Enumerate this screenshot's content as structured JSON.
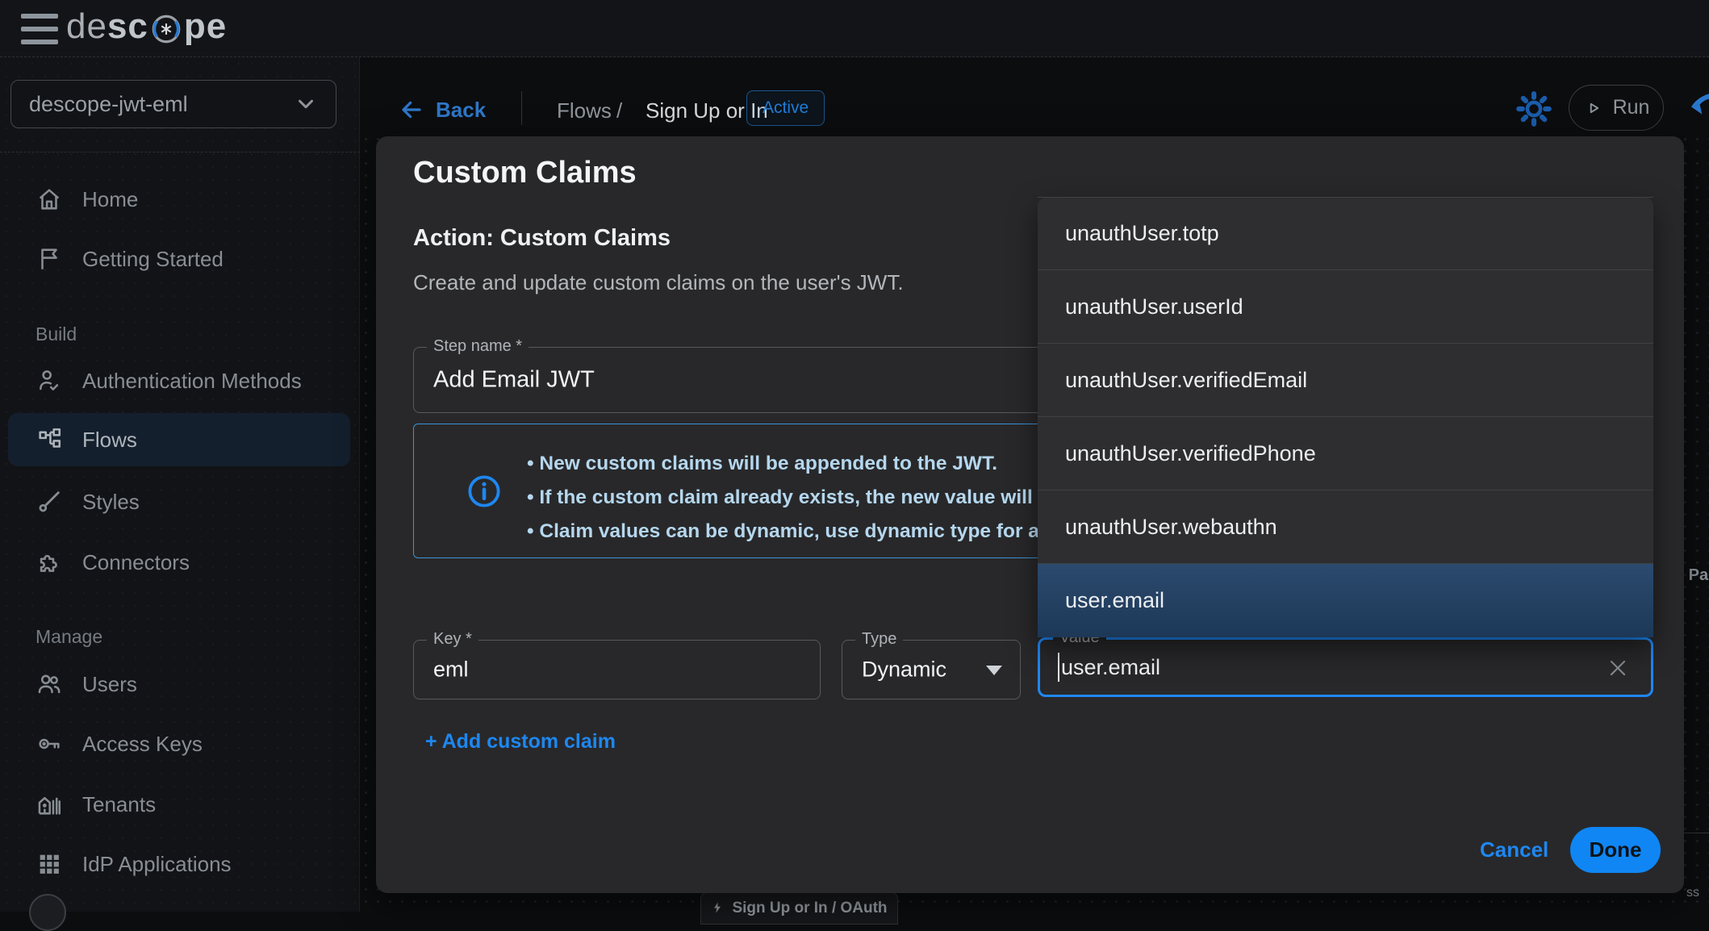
{
  "header": {
    "logo": {
      "prefix": "de",
      "mid": "sc",
      "suffix": "pe"
    }
  },
  "sidebar": {
    "project_selector": "descope-jwt-eml",
    "section_build": "Build",
    "section_manage": "Manage",
    "items": {
      "home": "Home",
      "getting_started": "Getting Started",
      "auth_methods": "Authentication Methods",
      "flows": "Flows",
      "styles": "Styles",
      "connectors": "Connectors",
      "users": "Users",
      "access_keys": "Access Keys",
      "tenants": "Tenants",
      "idp": "IdP Applications"
    }
  },
  "toolbar": {
    "back": "Back",
    "breadcrumb_parent": "Flows",
    "breadcrumb_sep": "/",
    "breadcrumb_current": "Sign Up or In",
    "status_badge": "Active",
    "run": "Run"
  },
  "modal": {
    "title": "Custom Claims",
    "action_title": "Action: Custom Claims",
    "description": "Create and update custom claims on the user's JWT.",
    "info_bullets": [
      "New custom claims will be appended to the JWT.",
      "If the custom claim already exists, the new value will override",
      "Claim values can be dynamic, use dynamic type for autocompl"
    ],
    "fields": {
      "step_name": {
        "label": "Step name *",
        "value": "Add Email JWT"
      },
      "key": {
        "label": "Key *",
        "value": "eml"
      },
      "type": {
        "label": "Type",
        "value": "Dynamic"
      },
      "value": {
        "label": "Value",
        "value": "user.email"
      }
    },
    "add_claim": "+ Add custom claim",
    "cancel": "Cancel",
    "done": "Done"
  },
  "autocomplete": {
    "options": [
      "unauthUser.totp",
      "unauthUser.userId",
      "unauthUser.verifiedEmail",
      "unauthUser.verifiedPhone",
      "unauthUser.webauthn",
      "user.email"
    ],
    "highlighted": "user.email"
  },
  "canvas": {
    "node_label": "Sign Up or In / OAuth",
    "fragment_right": "e Pass",
    "fragment_bottom": "ss"
  },
  "colors": {
    "accent": "#1e87f0",
    "done_button": "#1086f4",
    "focus_border": "#1f87f5",
    "info_border": "#3f93d6",
    "highlight_row_top": "#2b4a6e",
    "highlight_row_bottom": "#1d3857"
  }
}
